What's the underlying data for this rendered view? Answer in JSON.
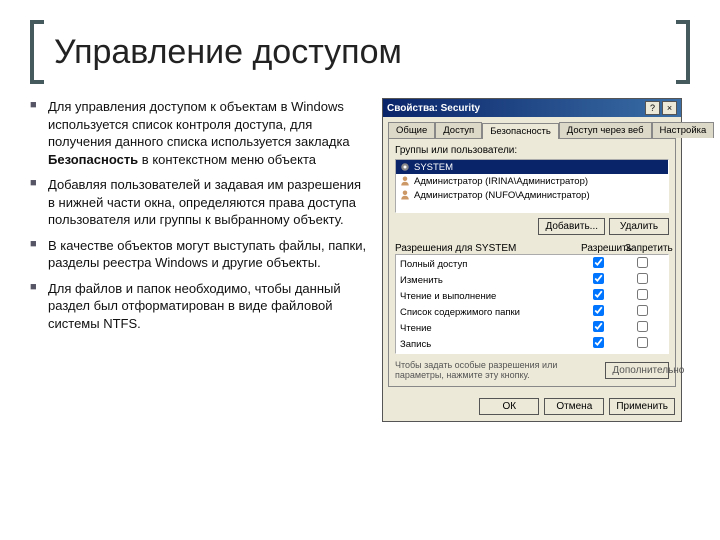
{
  "slide": {
    "title": "Управление доступом",
    "bullets": [
      {
        "pre": "Для управления доступом к объектам в Windows используется список контроля доступа, для получения данного списка используется закладка ",
        "bold": "Безопасность",
        "post": " в контекстном меню объекта"
      },
      {
        "pre": "Добавляя пользователей и задавая им разрешения в нижней части окна, определяются права доступа пользователя или группы к выбранному объекту.",
        "bold": "",
        "post": ""
      },
      {
        "pre": "В качестве объектов могут выступать файлы, папки, разделы реестра Windows и другие объекты.",
        "bold": "",
        "post": ""
      },
      {
        "pre": "Для файлов и папок необходимо, чтобы данный раздел был отформатирован в виде файловой системы NTFS.",
        "bold": "",
        "post": ""
      }
    ]
  },
  "dialog": {
    "title": "Свойства: Security",
    "help_btn": "?",
    "close_btn": "×",
    "tabs": [
      "Общие",
      "Доступ",
      "Безопасность",
      "Доступ через веб",
      "Настройка"
    ],
    "active_tab": 2,
    "group_label": "Группы или пользователи:",
    "principals": [
      {
        "name": "SYSTEM",
        "selected": true,
        "icon": "gear-icon"
      },
      {
        "name": "Администратор (IRINA\\Администратор)",
        "selected": false,
        "icon": "user-icon"
      },
      {
        "name": "Администратор (NUFO\\Администратор)",
        "selected": false,
        "icon": "user-icon"
      }
    ],
    "btn_add": "Добавить...",
    "btn_remove": "Удалить",
    "perm_label": "Разрешения для SYSTEM",
    "perm_allow": "Разрешить",
    "perm_deny": "Запретить",
    "permissions": [
      {
        "name": "Полный доступ",
        "allow": true,
        "deny": false
      },
      {
        "name": "Изменить",
        "allow": true,
        "deny": false
      },
      {
        "name": "Чтение и выполнение",
        "allow": true,
        "deny": false
      },
      {
        "name": "Список содержимого папки",
        "allow": true,
        "deny": false
      },
      {
        "name": "Чтение",
        "allow": true,
        "deny": false
      },
      {
        "name": "Запись",
        "allow": true,
        "deny": false
      }
    ],
    "note": "Чтобы задать особые разрешения или параметры, нажмите эту кнопку.",
    "btn_advanced": "Дополнительно",
    "btn_ok": "ОК",
    "btn_cancel": "Отмена",
    "btn_apply": "Применить"
  }
}
